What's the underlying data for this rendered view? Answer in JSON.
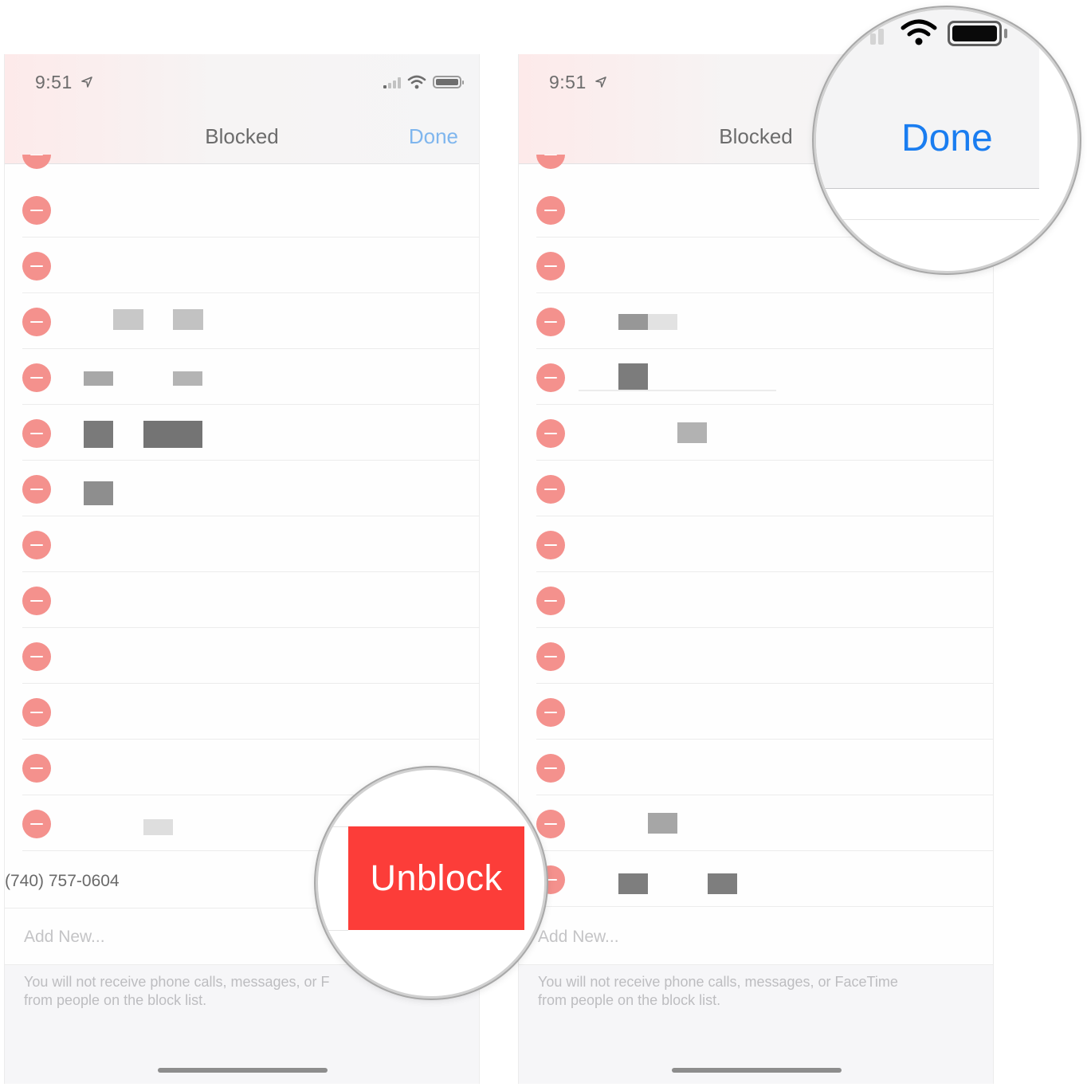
{
  "status": {
    "time": "9:51"
  },
  "nav": {
    "title": "Blocked",
    "done_label": "Done"
  },
  "blocked_number": "(740) 757-0604",
  "unblock_label": "Unblock",
  "add_new": "Add New...",
  "footer": {
    "left_text": "You will not receive phone calls, messages, or F",
    "left_text_line2": "from people on the block list.",
    "right_text": "You will not receive phone calls, messages, or FaceTime",
    "right_text_line2": "from people on the block list."
  },
  "zoom": {
    "done_label": "Done",
    "unblock_label": "Unblock"
  },
  "colors": {
    "delete_red": "#f4918d",
    "unblock_red": "#fc3d39",
    "ios_blue": "#1a7df0",
    "done_faded": "#7fb6ee"
  },
  "icons": [
    "location-arrow-icon",
    "signal-icon",
    "wifi-icon",
    "battery-icon",
    "minus-circle-icon"
  ]
}
